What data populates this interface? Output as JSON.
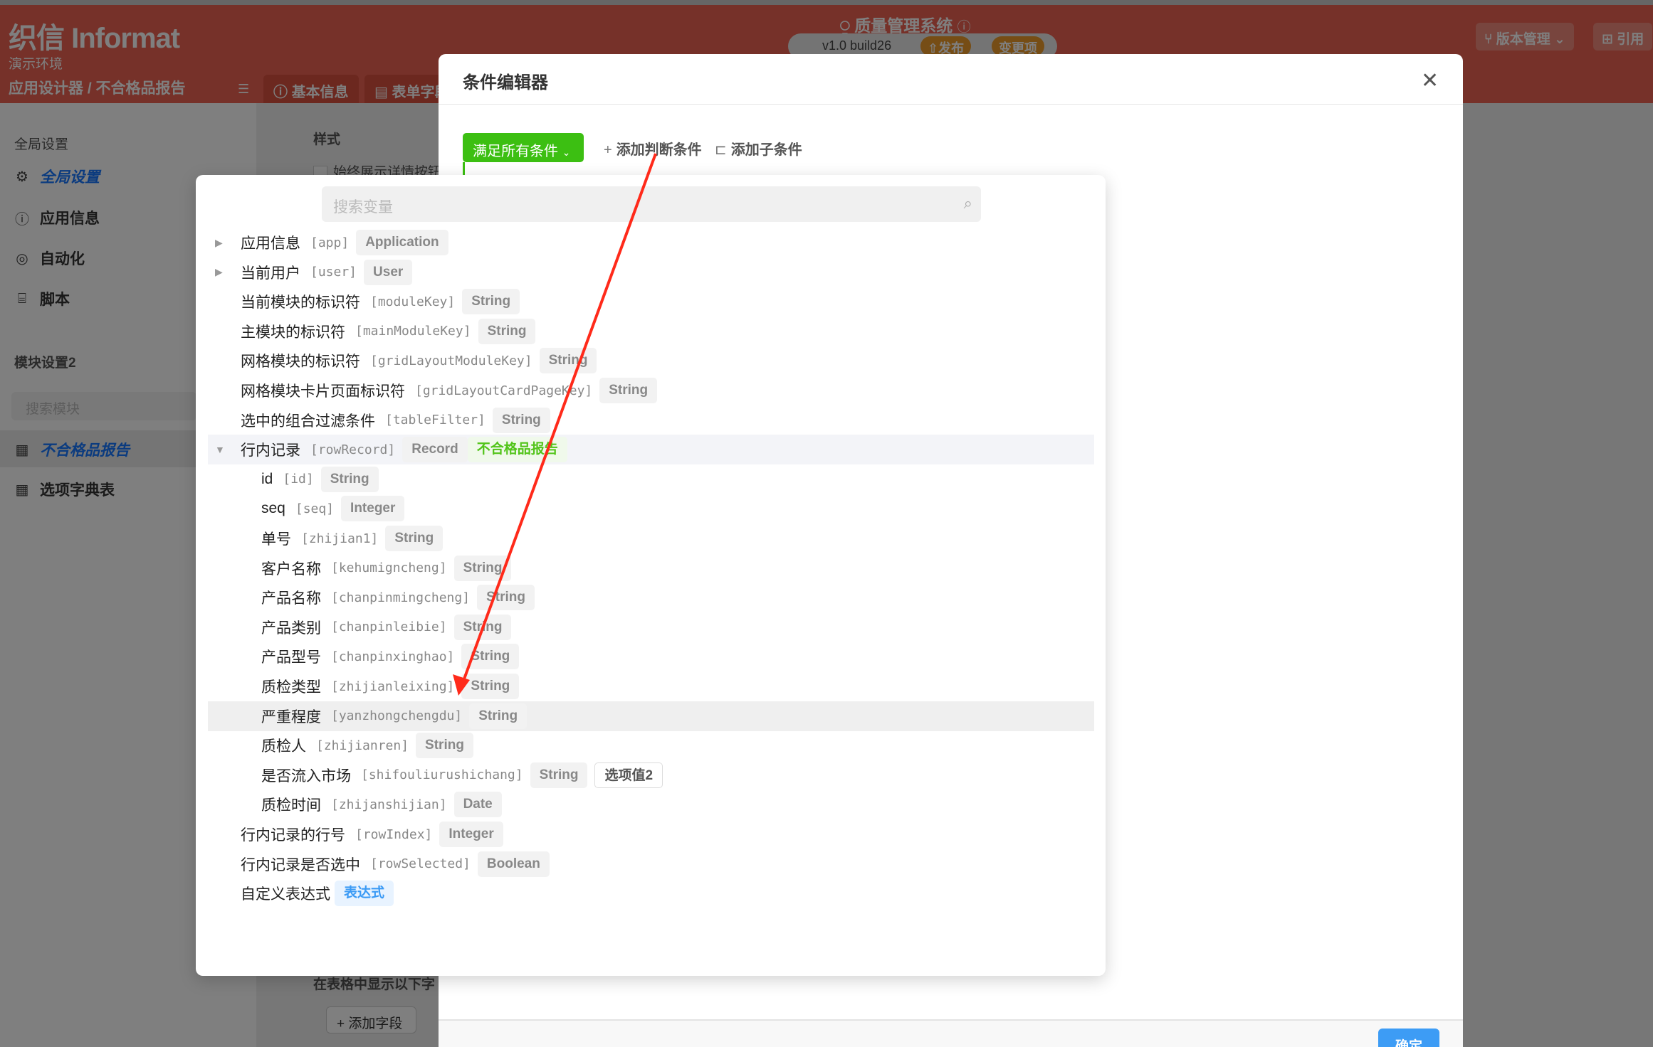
{
  "header": {
    "logo": "织信 Informat",
    "environment": "演示环境",
    "breadcrumb": "应用设计器 / 不合格品报告",
    "tabs": [
      "基本信息",
      "表单字段"
    ],
    "app_title": "质量管理系统",
    "version": "v1.0 build26",
    "publish_label": "发布",
    "changes_label": "变更项",
    "version_mgmt_label": "版本管理",
    "reference_label": "引用"
  },
  "sidebar": {
    "global_header": "全局设置",
    "items": [
      {
        "label": "全局设置",
        "icon": "gear-icon",
        "active": true
      },
      {
        "label": "应用信息",
        "icon": "info-icon"
      },
      {
        "label": "自动化",
        "icon": "automation-icon"
      },
      {
        "label": "脚本",
        "icon": "script-icon"
      }
    ],
    "module_header": "模块设置2",
    "module_search_placeholder": "搜索模块",
    "modules": [
      {
        "label": "不合格品报告",
        "icon": "table-icon",
        "active": true
      },
      {
        "label": "选项字典表",
        "icon": "table-icon"
      }
    ]
  },
  "background": {
    "style_label": "样式",
    "checkbox_label": "始终展示详情按钮",
    "table_fields_label": "在表格中显示以下字",
    "add_field_label": "添加字段"
  },
  "modal": {
    "title": "条件编辑器",
    "match_mode": "满足所有条件",
    "add_condition": "添加判断条件",
    "add_subcondition": "添加子条件",
    "confirm": "确定"
  },
  "variable_picker": {
    "search_placeholder": "搜索变量",
    "rows": [
      {
        "label": "应用信息",
        "key": "[app]",
        "level": 0,
        "expander": "collapsed",
        "tags": [
          {
            "text": "Application"
          }
        ]
      },
      {
        "label": "当前用户",
        "key": "[user]",
        "level": 0,
        "expander": "collapsed",
        "tags": [
          {
            "text": "User"
          }
        ]
      },
      {
        "label": "当前模块的标识符",
        "key": "[moduleKey]",
        "level": 0,
        "tags": [
          {
            "text": "String"
          }
        ]
      },
      {
        "label": "主模块的标识符",
        "key": "[mainModuleKey]",
        "level": 0,
        "tags": [
          {
            "text": "String"
          }
        ]
      },
      {
        "label": "网格模块的标识符",
        "key": "[gridLayoutModuleKey]",
        "level": 0,
        "tags": [
          {
            "text": "String"
          }
        ]
      },
      {
        "label": "网格模块卡片页面标识符",
        "key": "[gridLayoutCardPageKey]",
        "level": 0,
        "tags": [
          {
            "text": "String"
          }
        ]
      },
      {
        "label": "选中的组合过滤条件",
        "key": "[tableFilter]",
        "level": 0,
        "tags": [
          {
            "text": "String"
          }
        ]
      },
      {
        "label": "行内记录",
        "key": "[rowRecord]",
        "level": 0,
        "expander": "expanded",
        "highlight": "hl1",
        "tags": [
          {
            "text": "Record"
          },
          {
            "text": "不合格品报告",
            "style": "green"
          }
        ]
      },
      {
        "label": "id",
        "key": "[id]",
        "level": 1,
        "tags": [
          {
            "text": "String"
          }
        ]
      },
      {
        "label": "seq",
        "key": "[seq]",
        "level": 1,
        "tags": [
          {
            "text": "Integer"
          }
        ]
      },
      {
        "label": "单号",
        "key": "[zhijian1]",
        "level": 1,
        "tags": [
          {
            "text": "String"
          }
        ]
      },
      {
        "label": "客户名称",
        "key": "[kehumigncheng]",
        "level": 1,
        "tags": [
          {
            "text": "String"
          }
        ]
      },
      {
        "label": "产品名称",
        "key": "[chanpinmingcheng]",
        "level": 1,
        "tags": [
          {
            "text": "String"
          }
        ]
      },
      {
        "label": "产品类别",
        "key": "[chanpinleibie]",
        "level": 1,
        "tags": [
          {
            "text": "String"
          }
        ]
      },
      {
        "label": "产品型号",
        "key": "[chanpinxinghao]",
        "level": 1,
        "tags": [
          {
            "text": "String"
          }
        ]
      },
      {
        "label": "质检类型",
        "key": "[zhijianleixing]",
        "level": 1,
        "tags": [
          {
            "text": "String"
          }
        ]
      },
      {
        "label": "严重程度",
        "key": "[yanzhongchengdu]",
        "level": 1,
        "highlight": "hl2",
        "tags": [
          {
            "text": "String"
          }
        ]
      },
      {
        "label": "质检人",
        "key": "[zhijianren]",
        "level": 1,
        "tags": [
          {
            "text": "String"
          }
        ]
      },
      {
        "label": "是否流入市场",
        "key": "[shifouliurushichang]",
        "level": 1,
        "tags": [
          {
            "text": "String"
          },
          {
            "text": "选项值2",
            "style": "outline"
          }
        ]
      },
      {
        "label": "质检时间",
        "key": "[zhijanshijian]",
        "level": 1,
        "tags": [
          {
            "text": "Date"
          }
        ]
      },
      {
        "label": "行内记录的行号",
        "key": "[rowIndex]",
        "level": 0,
        "tags": [
          {
            "text": "Integer"
          }
        ]
      },
      {
        "label": "行内记录是否选中",
        "key": "[rowSelected]",
        "level": 0,
        "tags": [
          {
            "text": "Boolean"
          }
        ]
      },
      {
        "label": "自定义表达式",
        "key": "",
        "level": 0,
        "tags": [
          {
            "text": "表达式",
            "style": "blue"
          }
        ]
      }
    ]
  },
  "colors": {
    "header": "#ec6253",
    "accent_green": "#3cbf12",
    "primary_blue": "#3d9cf5",
    "annotation_arrow": "#ff2a1a"
  }
}
